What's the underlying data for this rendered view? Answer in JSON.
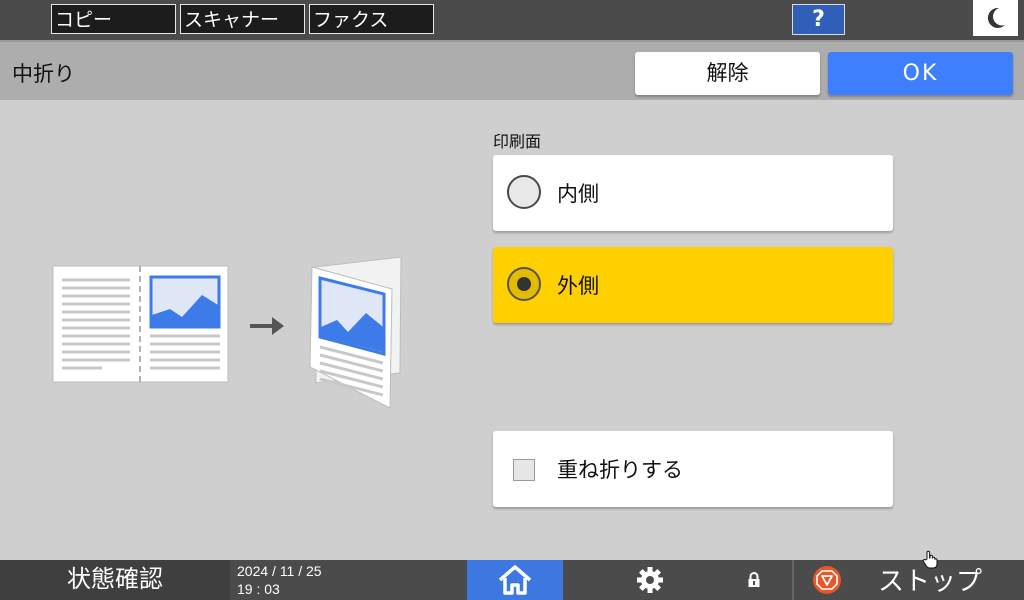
{
  "top_tabs": [
    "コピー",
    "スキャナー",
    "ファクス"
  ],
  "help_label": "?",
  "title": "中折り",
  "buttons": {
    "cancel": "解除",
    "ok": "OK"
  },
  "print_side": {
    "label": "印刷面",
    "options": [
      {
        "label": "内側",
        "selected": false
      },
      {
        "label": "外側",
        "selected": true
      }
    ]
  },
  "fold_over": {
    "label": "重ね折りする",
    "checked": false
  },
  "bottom": {
    "status": "状態確認",
    "date": "2024 / 11 / 25",
    "time": "19 : 03",
    "stop": "ストップ"
  },
  "colors": {
    "accent": "#3d7fff",
    "selected": "#ffd000",
    "home": "#3c78e0",
    "stop": "#e8562a"
  },
  "icons": [
    "moon-icon",
    "arrow-right-icon",
    "home-icon",
    "gear-icon",
    "lock-icon",
    "stop-icon"
  ]
}
